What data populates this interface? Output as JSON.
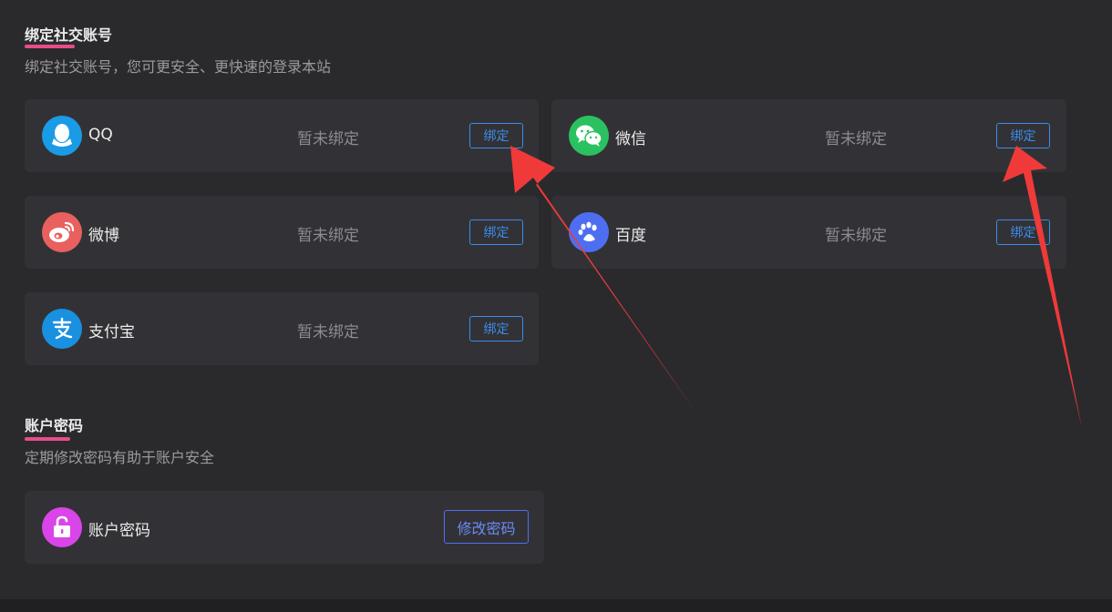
{
  "social": {
    "title": "绑定社交账号",
    "description": "绑定社交账号，您可更安全、更快速的登录本站",
    "accounts": [
      {
        "name": "QQ",
        "status": "暂未绑定",
        "button": "绑定",
        "icon": "qq-icon",
        "color": "#1a9be6"
      },
      {
        "name": "微信",
        "status": "暂未绑定",
        "button": "绑定",
        "icon": "wechat-icon",
        "color": "#2bc160"
      },
      {
        "name": "微博",
        "status": "暂未绑定",
        "button": "绑定",
        "icon": "weibo-icon",
        "color": "#e8615f"
      },
      {
        "name": "百度",
        "status": "暂未绑定",
        "button": "绑定",
        "icon": "baidu-paw-icon",
        "color": "#4e6ef2"
      },
      {
        "name": "支付宝",
        "status": "暂未绑定",
        "button": "绑定",
        "icon": "alipay-icon",
        "color": "#1a90e0"
      }
    ]
  },
  "password": {
    "title": "账户密码",
    "description": "定期修改密码有助于账户安全",
    "item_name": "账户密码",
    "button": "修改密码",
    "icon": "unlock-icon",
    "color": "#d945e8"
  },
  "colors": {
    "accent": "#3b8be6",
    "underline": "#e84d8a",
    "annotation_arrow": "#f03a3a"
  }
}
